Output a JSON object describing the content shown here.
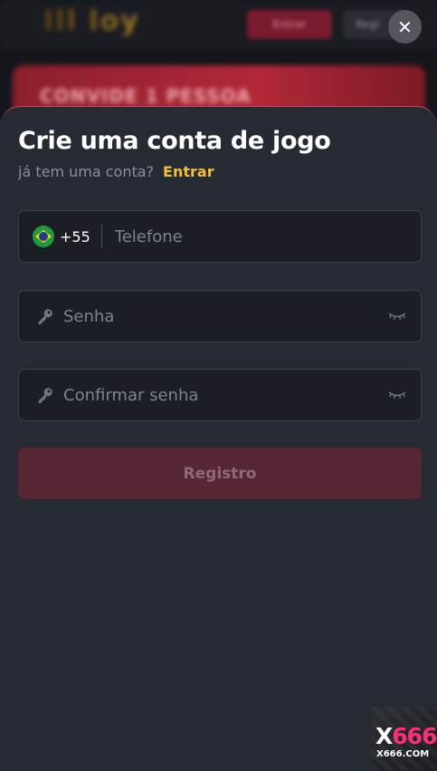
{
  "background": {
    "logo_text": "Ill loy",
    "login_button": "Entrar",
    "register_button": "Regi",
    "banner_text": "CONVIDE 1 PESSOA"
  },
  "modal": {
    "title": "Crie uma conta de jogo",
    "has_account_text": "já tem uma conta?",
    "login_link": "Entrar",
    "phone": {
      "country_code": "+55",
      "placeholder": "Telefone",
      "value": ""
    },
    "password": {
      "placeholder": "Senha",
      "value": ""
    },
    "confirm_password": {
      "placeholder": "Confirmar senha",
      "value": ""
    },
    "submit_label": "Registro"
  },
  "watermark": {
    "brand_x": "X",
    "brand_num": "666",
    "domain": "X666.COM"
  },
  "colors": {
    "sheet_bg": "#252a33",
    "field_bg": "#1b1f25",
    "accent_link": "#f2c036",
    "button_bg": "#562632",
    "sheet_border": "#c7475c"
  },
  "icons": {
    "close": "close-icon",
    "flag": "brazil-flag-icon",
    "password": "key-icon",
    "visibility": "eye-closed-icon"
  }
}
